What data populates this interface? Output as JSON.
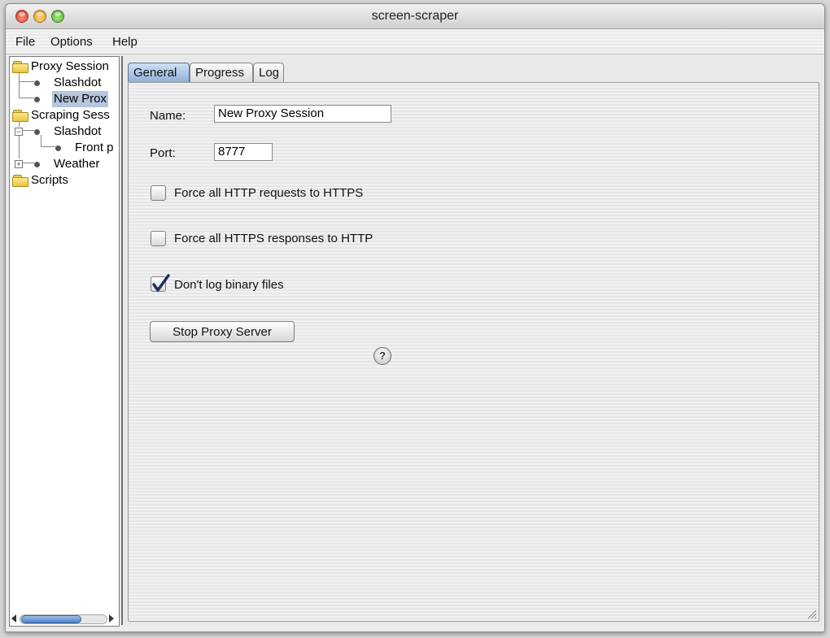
{
  "window": {
    "title": "screen-scraper"
  },
  "menu": {
    "items": [
      "File",
      "Options",
      "Help"
    ]
  },
  "tree": {
    "proxy_sessions": "Proxy Session",
    "proxy_slashdot": "Slashdot",
    "proxy_new": "New Prox",
    "scraping_sessions": "Scraping Sess",
    "scraping_slashdot": "Slashdot",
    "scraping_front": "Front p",
    "scraping_weather": "Weather",
    "scripts": "Scripts",
    "expander_slashdot": "−",
    "expander_weather": "+"
  },
  "tabs": {
    "general": "General",
    "progress": "Progress",
    "log": "Log"
  },
  "general": {
    "name_label": "Name:",
    "name_value": "New Proxy Session",
    "port_label": "Port:",
    "port_value": "8777",
    "force_https_label": "Force all HTTP requests to HTTPS",
    "force_http_label": "Force all HTTPS responses to HTTP",
    "no_binary_label": "Don't log binary files",
    "force_https_checked": false,
    "force_http_checked": false,
    "no_binary_checked": true,
    "stop_button": "Stop Proxy Server",
    "help_glyph": "?"
  }
}
